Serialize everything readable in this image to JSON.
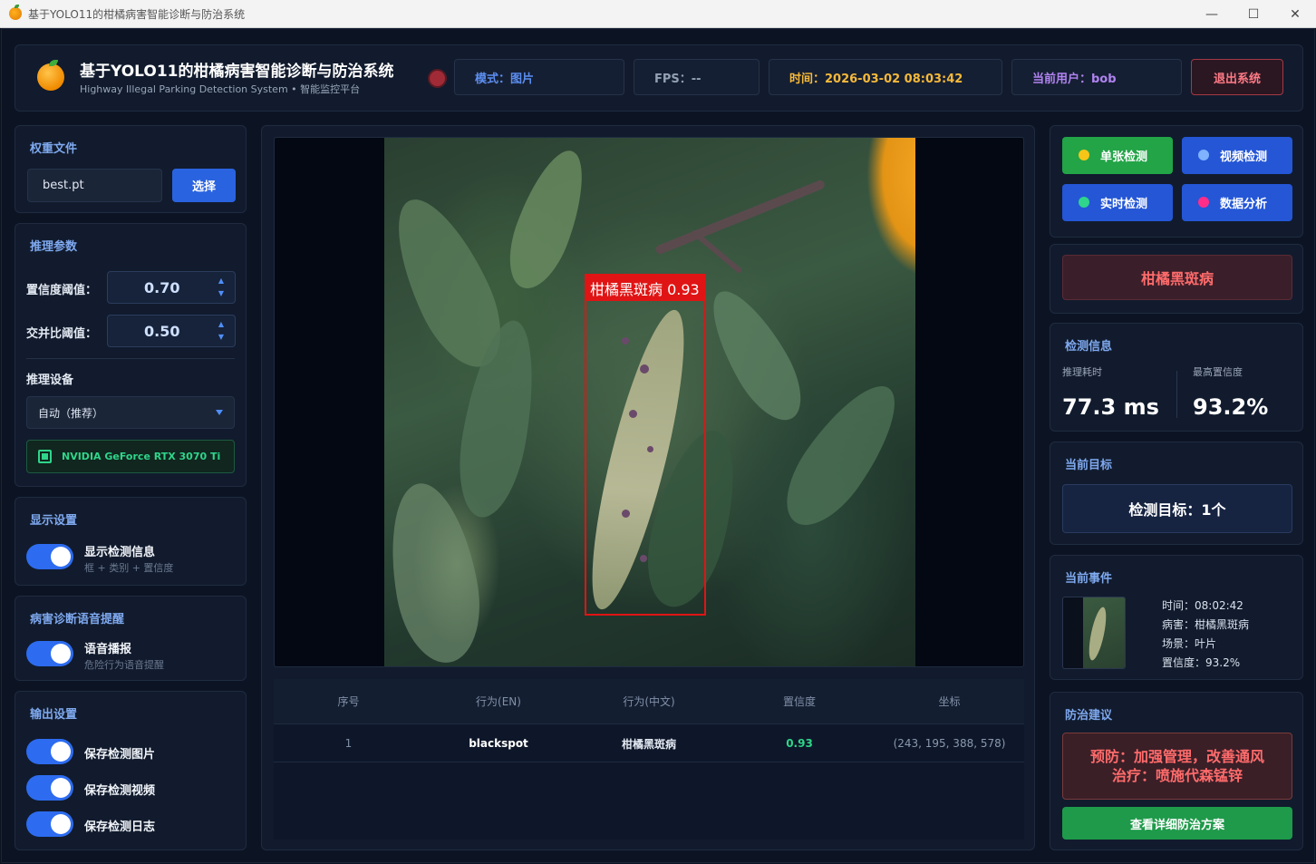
{
  "window": {
    "title": "基于YOLO11的柑橘病害智能诊断与防治系统",
    "minimize": "—",
    "maximize": "☐",
    "close": "✕"
  },
  "header": {
    "title": "基于YOLO11的柑橘病害智能诊断与防治系统",
    "subtitle": "Highway Illegal Parking Detection System • 智能监控平台",
    "status_color": "#a02a36",
    "mode": "模式：图片",
    "fps": "FPS：--",
    "time": "时间：2026-03-02 08:03:42",
    "user": "当前用户：bob",
    "logout": "退出系统"
  },
  "weights": {
    "title": "权重文件",
    "file": "best.pt",
    "choose": "选择"
  },
  "inference": {
    "title": "推理参数",
    "conf_label": "置信度阈值：",
    "conf_value": "0.70",
    "iou_label": "交并比阈值：",
    "iou_value": "0.50",
    "device_title": "推理设备",
    "device_selected": "自动（推荐）",
    "gpu": "NVIDIA GeForce RTX 3070 Ti"
  },
  "display": {
    "title": "显示设置",
    "show_info": "显示检测信息",
    "show_info_sub": "框 + 类别 + 置信度"
  },
  "voice": {
    "title": "病害诊断语音提醒",
    "broadcast": "语音播报",
    "broadcast_sub": "危险行为语音提醒"
  },
  "output": {
    "title": "输出设置",
    "save_image": "保存检测图片",
    "save_video": "保存检测视频",
    "save_log": "保存检测日志"
  },
  "viewer": {
    "detection_label": "柑橘黑斑病 0.93"
  },
  "table": {
    "headers": [
      "序号",
      "行为(EN)",
      "行为(中文)",
      "置信度",
      "坐标"
    ],
    "rows": [
      [
        "1",
        "blackspot",
        "柑橘黑斑病",
        "0.93",
        "(243, 195, 388, 578)"
      ]
    ]
  },
  "modes": {
    "single": "单张检测",
    "video": "视频检测",
    "realtime": "实时检测",
    "analysis": "数据分析",
    "dot_colors": [
      "#f5c518",
      "#7fb2ff",
      "#2fd58a",
      "#ff2d8a"
    ]
  },
  "result": {
    "label": "柑橘黑斑病"
  },
  "detect_info": {
    "title": "检测信息",
    "time_label": "推理耗时",
    "time_value": "77.3 ms",
    "conf_label": "最高置信度",
    "conf_value": "93.2%"
  },
  "target": {
    "title": "当前目标",
    "text": "检测目标：1个"
  },
  "event": {
    "title": "当前事件",
    "time": "时间：08:02:42",
    "disease": "病害：柑橘黑斑病",
    "scene": "场景：叶片",
    "conf": "置信度：93.2%"
  },
  "advice": {
    "title": "防治建议",
    "prevent": "预防：加强管理，改善通风",
    "treat": "治疗：喷施代森锰锌",
    "button": "查看详细防治方案"
  }
}
